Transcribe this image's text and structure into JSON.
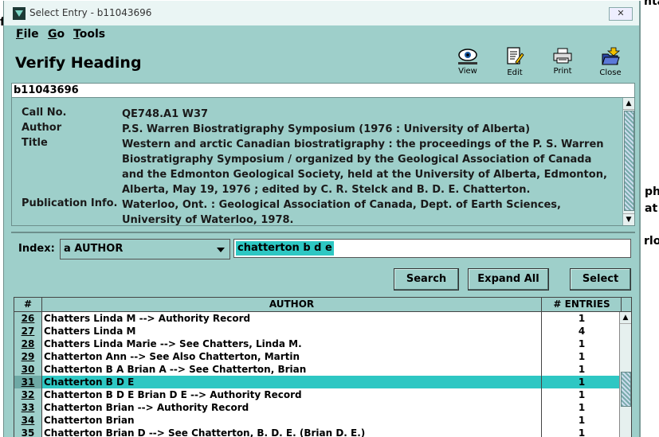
{
  "background": {
    "frag_top": "ntar",
    "frag_left": "f",
    "frag_right1": "ph",
    "frag_right2": "at",
    "frag_right3": "rloc"
  },
  "window": {
    "title": "Select Entry - b11043696",
    "close_label": "✕"
  },
  "menu": [
    {
      "label": "File",
      "key": "F",
      "rest": "ile"
    },
    {
      "label": "Go",
      "key": "G",
      "rest": "o"
    },
    {
      "label": "Tools",
      "key": "T",
      "rest": "ools"
    }
  ],
  "heading": "Verify Heading",
  "toolbar": {
    "view": "View",
    "edit": "Edit",
    "print": "Print",
    "close": "Close"
  },
  "record": {
    "id": "b11043696",
    "fields": [
      {
        "label": "Call No.",
        "value": "QE748.A1 W37"
      },
      {
        "label": "Author",
        "value": "P.S. Warren Biostratigraphy Symposium (1976 : University of Alberta)"
      },
      {
        "label": "Title",
        "value": "Western and arctic Canadian biostratigraphy : the proceedings of the P. S. Warren Biostratigraphy Symposium / organized by the Geological Association of Canada and the Edmonton Geological Society, held at the University of Alberta, Edmonton, Alberta, May 19, 1976 ; edited by C. R. Stelck and B. D. E. Chatterton."
      },
      {
        "label": "Publication Info.",
        "value": "Waterloo, Ont. : Geological Association of Canada, Dept. of Earth Sciences, University of Waterloo, 1978."
      }
    ]
  },
  "index": {
    "label": "Index:",
    "selected": "a AUTHOR",
    "search_value": "chatterton b d e"
  },
  "buttons": {
    "search": "Search",
    "expand_all": "Expand All",
    "select": "Select"
  },
  "grid": {
    "columns": [
      "#",
      "AUTHOR",
      "# ENTRIES"
    ],
    "rows": [
      {
        "num": "26",
        "author": "Chatters Linda M --> Authority Record",
        "entries": "1"
      },
      {
        "num": "27",
        "author": "Chatters Linda M",
        "entries": "4"
      },
      {
        "num": "28",
        "author": "Chatters Linda Marie --> See Chatters, Linda M.",
        "entries": "1"
      },
      {
        "num": "29",
        "author": "Chatterton Ann --> See Also Chatterton, Martin",
        "entries": "1"
      },
      {
        "num": "30",
        "author": "Chatterton B A Brian A --> See Chatterton, Brian",
        "entries": "1"
      },
      {
        "num": "31",
        "author": "Chatterton B D E",
        "entries": "1",
        "selected": true
      },
      {
        "num": "32",
        "author": "Chatterton B D E Brian D E --> Authority Record",
        "entries": "1"
      },
      {
        "num": "33",
        "author": "Chatterton Brian --> Authority Record",
        "entries": "1"
      },
      {
        "num": "34",
        "author": "Chatterton Brian",
        "entries": "1"
      },
      {
        "num": "35",
        "author": "Chatterton Brian D --> See Chatterton, B. D. E. (Brian D. E.)",
        "entries": "1"
      }
    ]
  }
}
